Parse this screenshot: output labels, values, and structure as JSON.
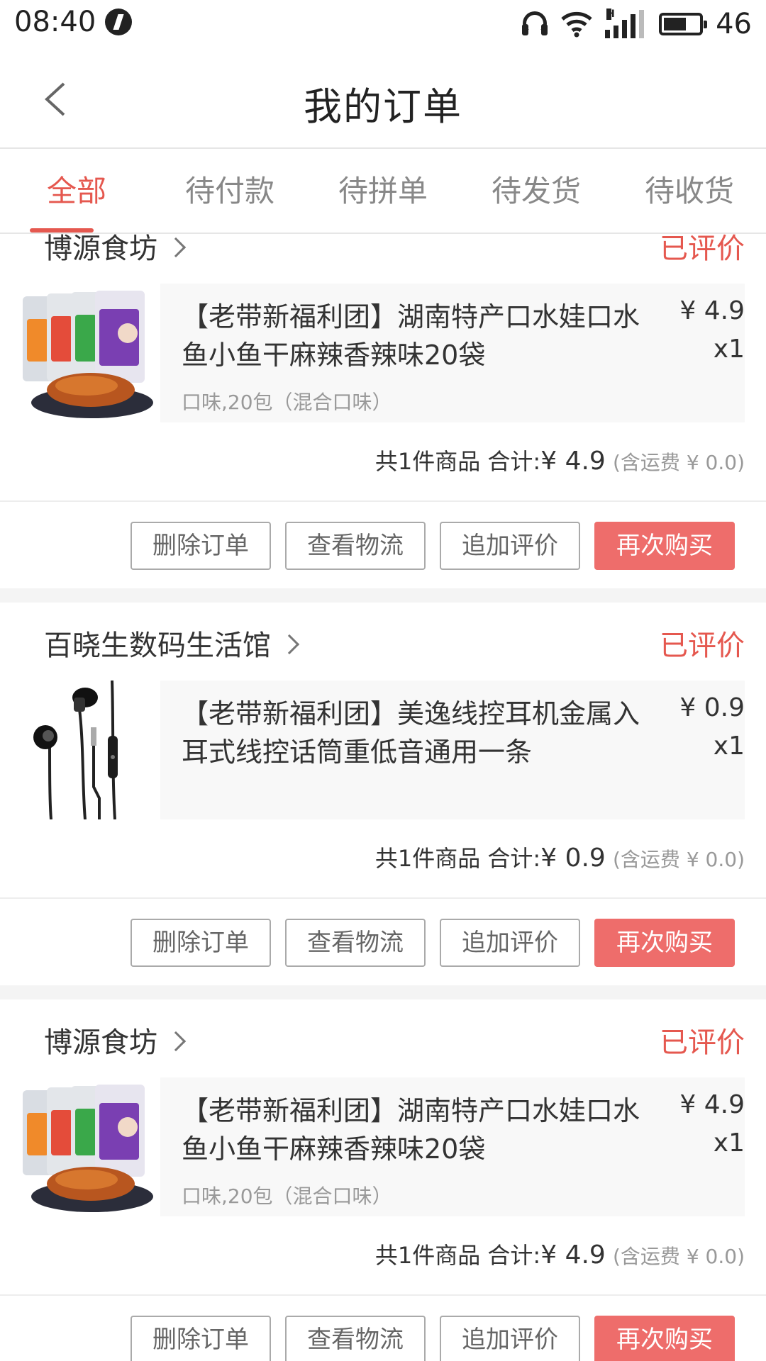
{
  "status_bar": {
    "time": "08:40",
    "network_label": "H",
    "battery": "46",
    "icons": [
      "notification-icon",
      "headset-icon",
      "wifi-icon",
      "signal-icon",
      "battery-icon"
    ]
  },
  "header": {
    "title": "我的订单",
    "back_icon": "chevron-left-icon"
  },
  "tabs": [
    {
      "label": "全部",
      "active": true
    },
    {
      "label": "待付款",
      "active": false
    },
    {
      "label": "待拼单",
      "active": false
    },
    {
      "label": "待发货",
      "active": false
    },
    {
      "label": "待收货",
      "active": false
    }
  ],
  "colors": {
    "accent": "#e5584f",
    "primary_button": "#ee6d6b",
    "card_background": "#f8f8f8",
    "divider": "#f4f4f4"
  },
  "orders": [
    {
      "shop": "博源食坊",
      "status": "已评价",
      "product": {
        "image": "snack-fish-package",
        "title": "【老带新福利团】湖南特产口水娃口水鱼小鱼干麻辣香辣味20袋",
        "spec": "口味,20包（混合口味）",
        "price": "¥ 4.9",
        "qty": "x1"
      },
      "summary": {
        "count_text": "共1件商品",
        "total_label": "合计:",
        "total": "¥ 4.9",
        "shipping": "(含运费 ¥ 0.0)"
      },
      "buttons": [
        "删除订单",
        "查看物流",
        "追加评价",
        "再次购买"
      ]
    },
    {
      "shop": "百晓生数码生活馆",
      "status": "已评价",
      "product": {
        "image": "wired-earphones",
        "title": "【老带新福利团】美逸线控耳机金属入耳式线控话筒重低音通用一条",
        "spec": "",
        "price": "¥ 0.9",
        "qty": "x1"
      },
      "summary": {
        "count_text": "共1件商品",
        "total_label": "合计:",
        "total": "¥ 0.9",
        "shipping": "(含运费 ¥ 0.0)"
      },
      "buttons": [
        "删除订单",
        "查看物流",
        "追加评价",
        "再次购买"
      ]
    },
    {
      "shop": "博源食坊",
      "status": "已评价",
      "product": {
        "image": "snack-fish-package",
        "title": "【老带新福利团】湖南特产口水娃口水鱼小鱼干麻辣香辣味20袋",
        "spec": "口味,20包（混合口味）",
        "price": "¥ 4.9",
        "qty": "x1"
      },
      "summary": {
        "count_text": "共1件商品",
        "total_label": "合计:",
        "total": "¥ 4.9",
        "shipping": "(含运费 ¥ 0.0)"
      },
      "buttons": [
        "删除订单",
        "查看物流",
        "追加评价",
        "再次购买"
      ]
    }
  ]
}
